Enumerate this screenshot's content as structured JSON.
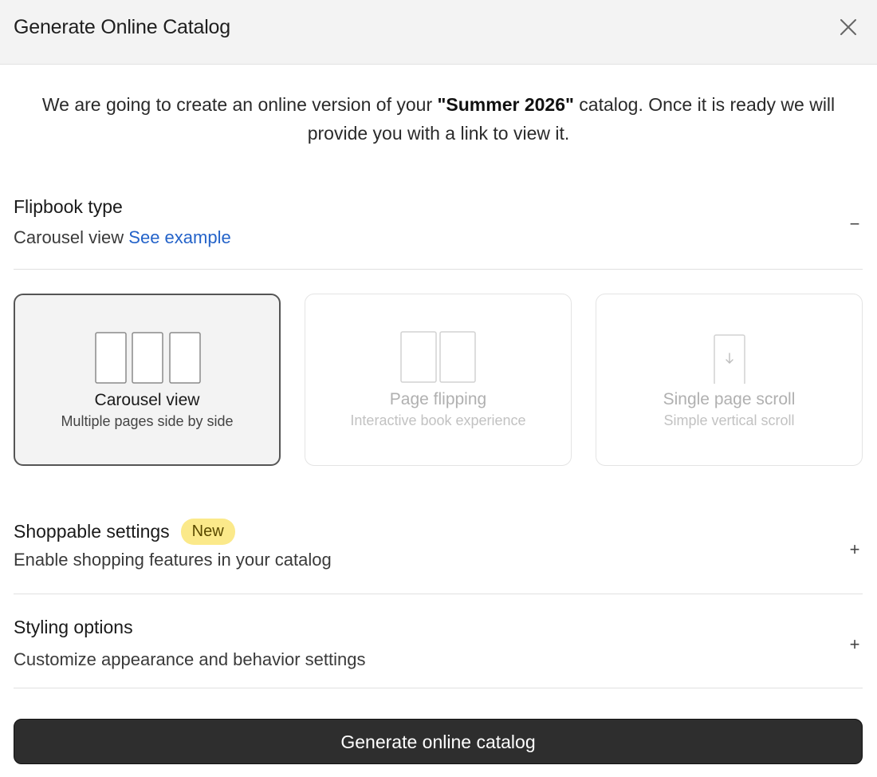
{
  "header": {
    "title": "Generate Online Catalog",
    "close_icon": "close-icon"
  },
  "intro": {
    "text_before": "We are going to create an online version of your ",
    "catalog_name": "\"Summer 2026\"",
    "text_after": " catalog. Once it is ready we will provide you with a link to view it."
  },
  "flipbook": {
    "title": "Flipbook type",
    "selected_label": "Carousel view",
    "example_link": "See example",
    "toggle": "−",
    "options": [
      {
        "title": "Carousel view",
        "desc": "Multiple pages side by side",
        "icon": "carousel-pages-icon",
        "selected": true
      },
      {
        "title": "Page flipping",
        "desc": "Interactive book experience",
        "icon": "book-pages-icon",
        "selected": false
      },
      {
        "title": "Single page scroll",
        "desc": "Simple vertical scroll",
        "icon": "scroll-page-icon",
        "selected": false
      }
    ]
  },
  "shoppable": {
    "title": "Shoppable settings",
    "badge": "New",
    "subtitle": "Enable shopping features in your catalog",
    "toggle": "+"
  },
  "styling": {
    "title": "Styling options",
    "subtitle": "Customize appearance and behavior settings",
    "toggle": "+"
  },
  "actions": {
    "generate_label": "Generate online catalog"
  },
  "colors": {
    "accent_link": "#2463c9",
    "badge_bg": "#fbe98a",
    "primary_button": "#2e2e2e",
    "selected_border": "#555555"
  }
}
